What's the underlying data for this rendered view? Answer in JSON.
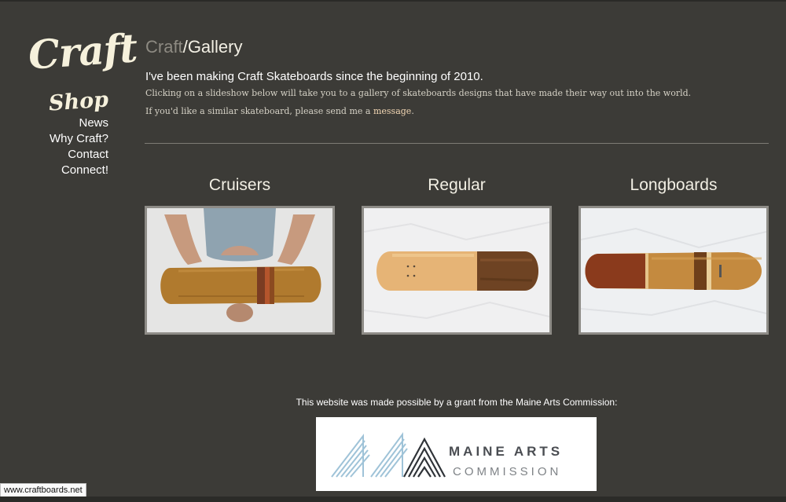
{
  "brand": {
    "logo_text": "Craft"
  },
  "nav": {
    "shop": "Shop",
    "items": [
      "News",
      "Why Craft?",
      "Contact",
      "Connect!"
    ]
  },
  "header": {
    "crumb": "Craft",
    "separator": "/",
    "current": "Gallery"
  },
  "intro": {
    "lead": "I've been making Craft Skateboards since the beginning of 2010.",
    "line1": "Clicking on a slideshow below will take you to a gallery of skateboards designs that have made their way out into the world.",
    "line2_prefix": "If you'd like a similar skateboard, please send me a",
    "line2_link": "message",
    "line2_suffix": "."
  },
  "gallery": [
    {
      "title": "Cruisers"
    },
    {
      "title": "Regular"
    },
    {
      "title": "Longboards"
    }
  ],
  "footer": {
    "grant_text": "This website was made possible by a grant from the Maine Arts Commission:",
    "logo_line1": "MAINE ARTS",
    "logo_line2": "COMMISSION"
  },
  "status_bar": {
    "url": "www.craftboards.net"
  },
  "colors": {
    "background": "#3c3b37",
    "link": "#f3d7b4",
    "muted": "#8d8a82"
  }
}
